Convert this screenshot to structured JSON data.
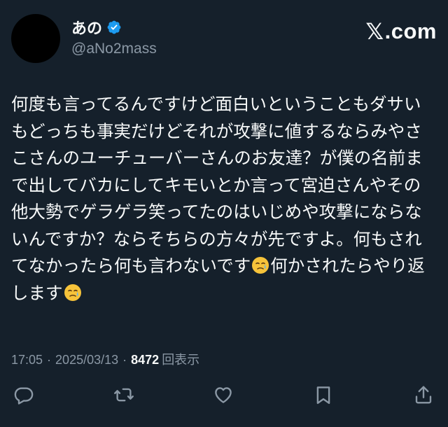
{
  "author": {
    "display_name": "あの",
    "handle": "@aNo2mass",
    "verified": true
  },
  "brand": {
    "x_glyph": "𝕏",
    "suffix": ".com"
  },
  "tweet": {
    "text_part1": "何度も言ってるんですけど面白いということもダサいもどっちも事実だけどそれが攻撃に値するならみやさこさんのユーチューバーさんのお友達？が僕の名前まで出してバカにしてキモいとか言って宮迫さんやその他大勢でゲラゲラ笑ってたのはいじめや攻撃にならないんですか？ならそちらの方々が先ですよ。何もされてなかったら何も言わないです",
    "emoji_1": "crying-face-emoji",
    "text_part2": "何かされたらやり返します",
    "emoji_2": "crying-face-emoji"
  },
  "meta": {
    "time": "17:05",
    "separator": "·",
    "date": "2025/03/13",
    "views_count": "8472",
    "views_label": "回表示"
  },
  "actions": {
    "reply": "reply-icon",
    "retweet": "retweet-icon",
    "like": "heart-icon",
    "bookmark": "bookmark-icon",
    "share": "share-icon"
  },
  "colors": {
    "background": "#15202b",
    "text": "#f7f9f9",
    "secondary": "#8b98a5",
    "verified": "#1d9bf0"
  }
}
